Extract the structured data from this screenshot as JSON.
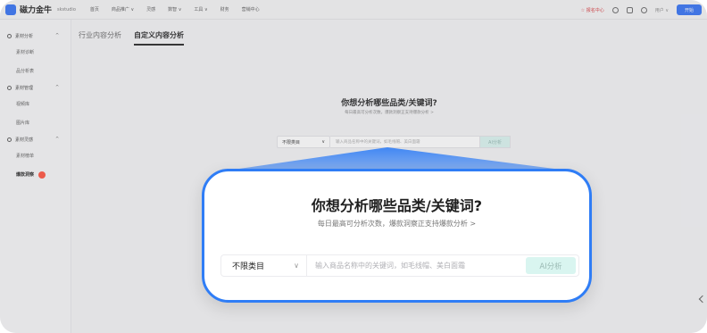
{
  "app": {
    "title": "磁力金牛",
    "shop_name": "skstudio"
  },
  "topnav": [
    "首页",
    "商品推广 ∨",
    "灵感",
    "数智 ∨",
    "工具 ∨",
    "财务",
    "营销中心"
  ],
  "top_right": {
    "vip_label": "☆ 报名中心",
    "grid_icon": "grid-icon",
    "user": "用户 ∨",
    "button_label": "开始"
  },
  "sidebar": {
    "groups": [
      {
        "label": "素材分析",
        "items": [
          "素材诊断",
          "品分析表"
        ]
      },
      {
        "label": "素材管理",
        "items": [
          "视频库",
          "图片库"
        ]
      },
      {
        "label": "素材灵感",
        "items": [
          "素材榜单",
          "爆款洞察"
        ]
      }
    ],
    "active_item": "爆款洞察"
  },
  "tabs": [
    "行业内容分析",
    "自定义内容分析"
  ],
  "active_tab": "自定义内容分析",
  "prompt": {
    "title": "你想分析哪些品类/关键词?",
    "subtitle": "每日最高可分析次数，爆款洞察正支持爆款分析 >"
  },
  "search": {
    "category_value": "不限类目",
    "placeholder": "输入商品名称中的关键词，如毛线帽、美白面霜",
    "button_label": "AI分析"
  },
  "colors": {
    "accent": "#2f7df6",
    "button_bg": "#d9f5f0",
    "badge": "#ff4d3a"
  }
}
